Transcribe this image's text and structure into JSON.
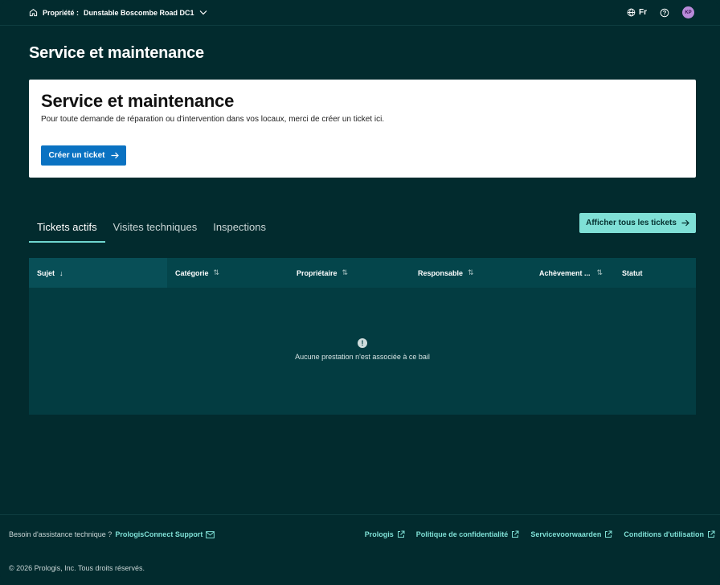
{
  "header": {
    "property_label": "Propriété :",
    "property_name": "Dunstable Boscombe Road DC1",
    "language": "Fr",
    "avatar_initials": "KP"
  },
  "page": {
    "title": "Service et maintenance"
  },
  "card": {
    "title": "Service et maintenance",
    "description": "Pour toute demande de réparation ou d'intervention dans vos locaux, merci de créer un ticket ici.",
    "button_label": "Créer un ticket"
  },
  "tabs": [
    {
      "label": "Tickets actifs",
      "active": true
    },
    {
      "label": "Visites techniques",
      "active": false
    },
    {
      "label": "Inspections",
      "active": false
    }
  ],
  "show_all_button": "Afficher tous les tickets",
  "table": {
    "columns": [
      {
        "label": "Sujet",
        "sort": "↓"
      },
      {
        "label": "Catégorie",
        "sort": "⇅"
      },
      {
        "label": "Propriétaire",
        "sort": "⇅"
      },
      {
        "label": "Responsable",
        "sort": "⇅"
      },
      {
        "label": "Achèvement ...",
        "sort": "⇅"
      },
      {
        "label": "Statut",
        "sort": ""
      }
    ],
    "empty_message": "Aucune prestation n'est associée à ce bail",
    "empty_icon": "!"
  },
  "footer": {
    "help_text": "Besoin d'assistance technique ?",
    "support_link": "PrologisConnect Support",
    "links": [
      "Prologis",
      "Politique de confidentialité",
      "Servicevoorwaarden",
      "Conditions d'utilisation"
    ],
    "copyright": "© 2026 Prologis, Inc. Tous droits réservés."
  },
  "colors": {
    "background": "#022b2e",
    "primary_button": "#0a72c2",
    "accent_teal": "#7fe0d6",
    "table_bg": "#033c41",
    "avatar": "#b98ad9"
  }
}
